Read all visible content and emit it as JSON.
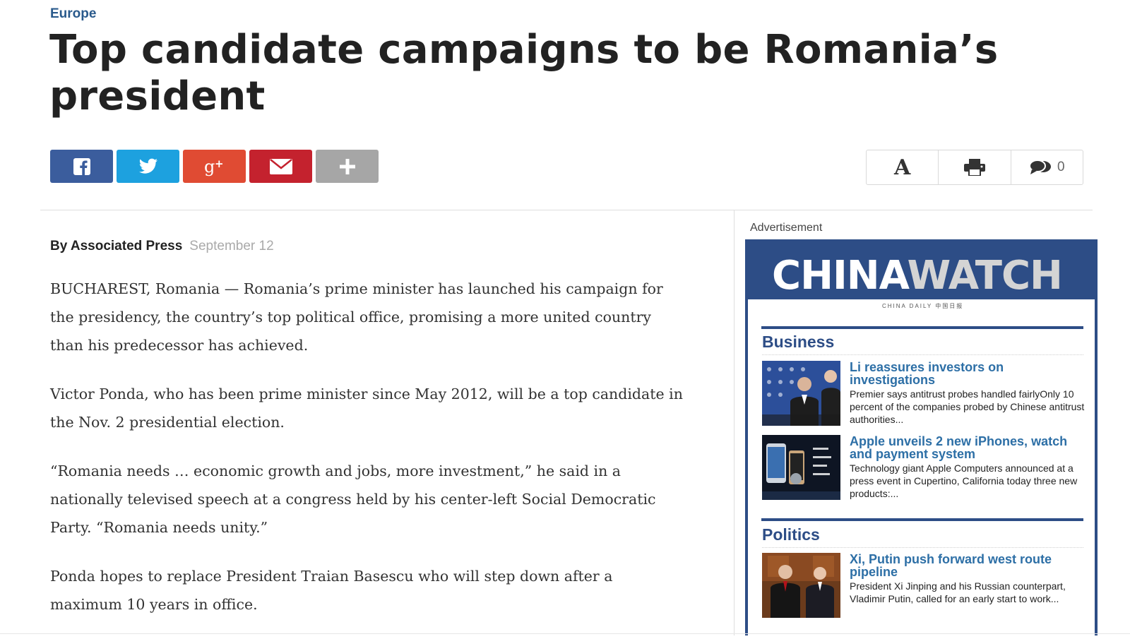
{
  "article": {
    "section": "Europe",
    "headline": "Top candidate campaigns to be Romania’s president",
    "author": "By Associated Press",
    "date": "September 12",
    "paragraphs": [
      "BUCHAREST, Romania — Romania’s prime minister has launched his campaign for the presidency, the country’s top political office, promising a more united country than his predecessor has achieved.",
      "Victor Ponda, who has been prime minister since May 2012, will be a top candidate in the Nov. 2 presidential election.",
      "“Romania needs … economic growth and jobs, more investment,” he said in a nationally televised speech at a congress held by his center-left Social Democratic Party. “Romania needs unity.”",
      "Ponda hopes to replace President Traian Basescu who will step down after a maximum 10 years in office."
    ]
  },
  "share": {
    "buttons": [
      {
        "icon": "facebook-icon",
        "color": "#3b5d9d"
      },
      {
        "icon": "twitter-icon",
        "color": "#1da1df"
      },
      {
        "icon": "google-plus-icon",
        "color": "#e04b33"
      },
      {
        "icon": "email-icon",
        "color": "#c4222e"
      },
      {
        "icon": "plus-icon",
        "color": "#a6a6a6"
      }
    ]
  },
  "tools": {
    "font_size_label": "A",
    "print_icon": "print-icon",
    "comments_icon": "comments-icon",
    "comment_count": "0"
  },
  "sidebar": {
    "ad_label": "Advertisement",
    "ad": {
      "logo_part1": "CHINA",
      "logo_part2": "WATCH",
      "logo_sub": "CHINA DAILY 中国日报",
      "brand_color": "#2d4d86",
      "sections": [
        {
          "title": "Business",
          "stories": [
            {
              "title": "Li reassures investors on investigations",
              "desc": "Premier says antitrust probes handled fairlyOnly 10 percent of the companies probed by Chinese antitrust authorities...",
              "thumb": "forum-photo"
            },
            {
              "title": "Apple unveils 2 new iPhones, watch and payment system",
              "desc": "Technology giant Apple Computers announced at a press event in Cupertino, California today three new products:...",
              "thumb": "iphone-photo"
            }
          ]
        },
        {
          "title": "Politics",
          "stories": [
            {
              "title": "Xi, Putin push forward west route pipeline",
              "desc": "President Xi Jinping and his Russian counterpart, Vladimir Putin, called for an early start to work...",
              "thumb": "leaders-photo"
            }
          ]
        }
      ]
    }
  }
}
